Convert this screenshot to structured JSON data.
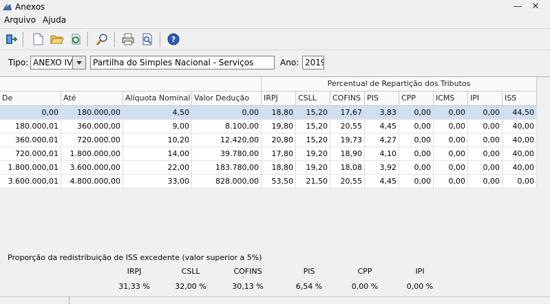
{
  "window": {
    "title": "Anexos",
    "minimize": "—",
    "close": "✕"
  },
  "menu": [
    "Arquivo",
    "Ajuda"
  ],
  "toolbar": [
    "exit-icon",
    "new-document-icon",
    "open-folder-icon",
    "refresh-icon",
    "search-icon",
    "print-icon",
    "print-preview-icon",
    "help-icon"
  ],
  "filter": {
    "tipo_label": "Tipo:",
    "tipo_value": "ANEXO IV",
    "description": "Partilha do Simples Nacional - Serviços",
    "ano_label": "Ano:",
    "ano_value": "2019"
  },
  "table": {
    "group_header": "Percentual de Repartição dos Tributos",
    "columns": [
      "De",
      "Até",
      "Alíquota Nominal",
      "Valor Dedução",
      "IRPJ",
      "CSLL",
      "COFINS",
      "PIS",
      "CPP",
      "ICMS",
      "IPI",
      "ISS"
    ],
    "rows": [
      [
        "0,00",
        "180.000,00",
        "4,50",
        "0,00",
        "18,80",
        "15,20",
        "17,67",
        "3,83",
        "0,00",
        "0,00",
        "0,00",
        "44,50"
      ],
      [
        "180.000,01",
        "360.000,00",
        "9,00",
        "8.100,00",
        "19,80",
        "15,20",
        "20,55",
        "4,45",
        "0,00",
        "0,00",
        "0,00",
        "40,00"
      ],
      [
        "360.000,01",
        "720.000,00",
        "10,20",
        "12.420,00",
        "20,80",
        "15,20",
        "19,73",
        "4,27",
        "0,00",
        "0,00",
        "0,00",
        "40,00"
      ],
      [
        "720.000,01",
        "1.800.000,00",
        "14,00",
        "39.780,00",
        "17,80",
        "19,20",
        "18,90",
        "4,10",
        "0,00",
        "0,00",
        "0,00",
        "40,00"
      ],
      [
        "1.800.000,01",
        "3.600.000,00",
        "22,00",
        "183.780,00",
        "18,80",
        "19,20",
        "18,08",
        "3,92",
        "0,00",
        "0,00",
        "0,00",
        "40,00"
      ],
      [
        "3.600.000,01",
        "4.800.000,00",
        "33,00",
        "828.000,00",
        "53,50",
        "21,50",
        "20,55",
        "4,45",
        "0,00",
        "0,00",
        "0,00",
        "0,00"
      ]
    ],
    "selected_row": 0,
    "selected_color": "#cfe0f3"
  },
  "redistribution": {
    "title": "Proporção da redistribuição de ISS excedente (valor superior a 5%)",
    "headers": [
      "IRPJ",
      "CSLL",
      "COFINS",
      "PIS",
      "CPP",
      "IPI"
    ],
    "values": [
      "31,33 %",
      "32,00 %",
      "30,13 %",
      "6,54 %",
      "0,00 %",
      "0,00 %"
    ]
  }
}
